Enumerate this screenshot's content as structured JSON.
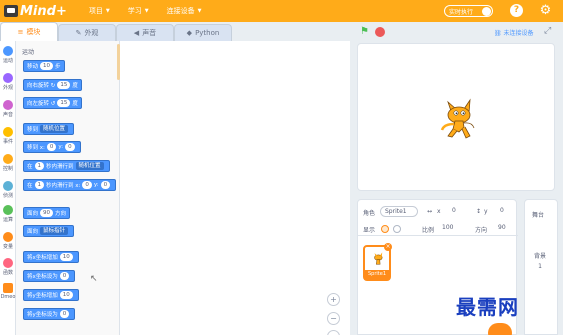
{
  "app": {
    "logo_text": "Mind+",
    "menu": [
      {
        "label": "项目"
      },
      {
        "label": "学习"
      },
      {
        "label": "连接设备"
      }
    ],
    "realtime_label": "实时执行",
    "help_label": "?",
    "accent_color": "#ffab19"
  },
  "tabs": [
    {
      "label": "模块",
      "icon": "blocks-icon"
    },
    {
      "label": "外观",
      "icon": "brush-icon"
    },
    {
      "label": "声音",
      "icon": "speaker-icon"
    },
    {
      "label": "Python",
      "icon": "python-icon"
    }
  ],
  "categories": [
    {
      "label": "运动",
      "color": "#4c97ff"
    },
    {
      "label": "外观",
      "color": "#9966ff"
    },
    {
      "label": "声音",
      "color": "#cf63cf"
    },
    {
      "label": "事件",
      "color": "#ffbf00"
    },
    {
      "label": "控制",
      "color": "#ffab19"
    },
    {
      "label": "侦测",
      "color": "#5cb1d6"
    },
    {
      "label": "运算",
      "color": "#59c059"
    },
    {
      "label": "变量",
      "color": "#ff8c1a"
    },
    {
      "label": "函数",
      "color": "#ff6680"
    },
    {
      "label": "Dmeo",
      "color": "#ff8c1a"
    }
  ],
  "palette": {
    "heading": "运动",
    "blocks": [
      {
        "text": "移动",
        "value": "10",
        "suffix": "步"
      },
      {
        "text": "向右旋转 ↻",
        "value": "15",
        "suffix": "度"
      },
      {
        "text": "向左旋转 ↺",
        "value": "15",
        "suffix": "度"
      },
      {
        "text": "移到",
        "dropdown": "随机位置"
      },
      {
        "text": "移到 x:",
        "value": "0",
        "mid": "y:",
        "value2": "0"
      },
      {
        "text": "在",
        "value": "1",
        "mid": "秒内滑行到",
        "dropdown": "随机位置"
      },
      {
        "text": "在",
        "value": "1",
        "mid": "秒内滑行到 x:",
        "value2": "0",
        "mid2": "y:",
        "value3": "0"
      },
      {
        "text": "面向",
        "value": "90",
        "suffix": "方向"
      },
      {
        "text": "面向",
        "dropdown": "鼠标指针"
      },
      {
        "text": "将x坐标增加",
        "value": "10"
      },
      {
        "text": "将x坐标设为",
        "value": "0"
      },
      {
        "text": "将y坐标增加",
        "value": "10"
      },
      {
        "text": "将y坐标设为",
        "value": "0"
      }
    ]
  },
  "stage_header": {
    "device_status": "未连接设备"
  },
  "sprite_info": {
    "sprite_label": "角色",
    "sprite_name": "Sprite1",
    "x_label": "x",
    "x_value": "0",
    "y_label": "y",
    "y_value": "0",
    "show_label": "显示",
    "size_label": "比例",
    "size_value": "100",
    "direction_label": "方向",
    "direction_value": "90"
  },
  "sprite_list": [
    {
      "name": "Sprite1"
    }
  ],
  "backdrop": {
    "title": "舞台",
    "subtitle": "背景",
    "count": "1"
  },
  "watermark": "最需网"
}
